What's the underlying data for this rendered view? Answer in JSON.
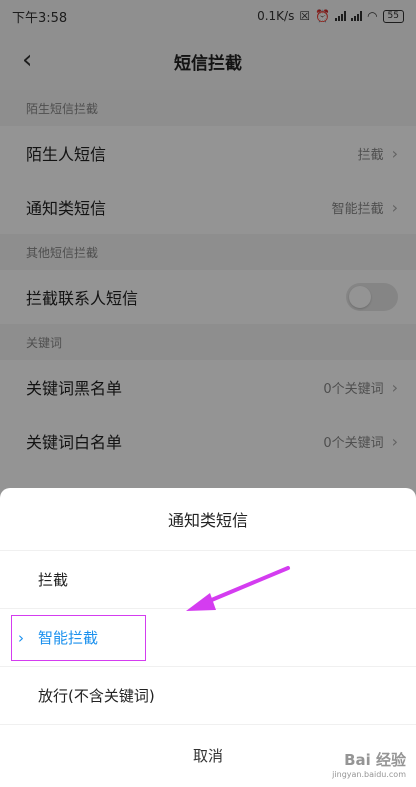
{
  "status_bar": {
    "time": "下午3:58",
    "network_speed": "0.1K/s",
    "battery": "55"
  },
  "header": {
    "back_icon": "back-chevron-icon",
    "title": "短信拦截"
  },
  "sections": {
    "stranger": {
      "label": "陌生短信拦截",
      "rows": [
        {
          "label": "陌生人短信",
          "value": "拦截"
        },
        {
          "label": "通知类短信",
          "value": "智能拦截"
        }
      ]
    },
    "other": {
      "label": "其他短信拦截",
      "row": {
        "label": "拦截联系人短信",
        "toggle_on": false
      }
    },
    "keywords": {
      "label": "关键词",
      "rows": [
        {
          "label": "关键词黑名单",
          "value": "0个关键词"
        },
        {
          "label": "关键词白名单",
          "value": "0个关键词"
        }
      ]
    }
  },
  "sheet": {
    "title": "通知类短信",
    "options": [
      "拦截",
      "智能拦截",
      "放行(不含关键词)"
    ],
    "selected_index": 1,
    "cancel_label": "取消"
  },
  "colors": {
    "accent": "#1a90ee",
    "annotation": "#d43cf0"
  },
  "watermark": {
    "main": "Bai 经验",
    "sub": "jingyan.baidu.com"
  }
}
